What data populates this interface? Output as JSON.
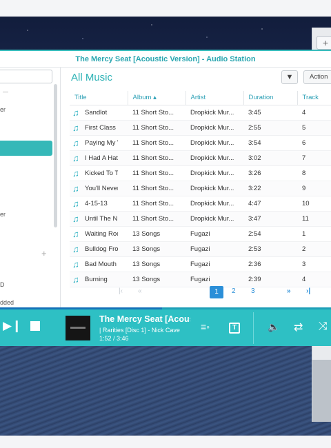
{
  "window": {
    "title": "The Mercy Seat [Acoustic Version] - Audio Station"
  },
  "sidebar": {
    "search_placeholder": "",
    "items": [
      {
        "label": "er"
      },
      {
        "label": "er"
      },
      {
        "label": "D"
      },
      {
        "label": "dded"
      }
    ]
  },
  "main": {
    "heading": "All Music",
    "action_label": "Action",
    "columns": [
      "Title",
      "Album ▴",
      "Artist",
      "Duration",
      "Track"
    ],
    "rows": [
      {
        "title": "Sandlot",
        "album": "11 Short Sto...",
        "artist": "Dropkick Mur...",
        "duration": "3:45",
        "track": "4"
      },
      {
        "title": "First Class I",
        "album": "11 Short Sto...",
        "artist": "Dropkick Mur...",
        "duration": "2:55",
        "track": "5"
      },
      {
        "title": "Paying My V",
        "album": "11 Short Sto...",
        "artist": "Dropkick Mur...",
        "duration": "3:54",
        "track": "6"
      },
      {
        "title": "I Had A Hat",
        "album": "11 Short Sto...",
        "artist": "Dropkick Mur...",
        "duration": "3:02",
        "track": "7"
      },
      {
        "title": "Kicked To T",
        "album": "11 Short Sto...",
        "artist": "Dropkick Mur...",
        "duration": "3:26",
        "track": "8"
      },
      {
        "title": "You'll Never",
        "album": "11 Short Sto...",
        "artist": "Dropkick Mur...",
        "duration": "3:22",
        "track": "9"
      },
      {
        "title": "4-15-13",
        "album": "11 Short Sto...",
        "artist": "Dropkick Mur...",
        "duration": "4:47",
        "track": "10"
      },
      {
        "title": "Until The N",
        "album": "11 Short Sto...",
        "artist": "Dropkick Mur...",
        "duration": "3:47",
        "track": "11"
      },
      {
        "title": "Waiting Roo",
        "album": "13 Songs",
        "artist": "Fugazi",
        "duration": "2:54",
        "track": "1"
      },
      {
        "title": "Bulldog Fro",
        "album": "13 Songs",
        "artist": "Fugazi",
        "duration": "2:53",
        "track": "2"
      },
      {
        "title": "Bad Mouth",
        "album": "13 Songs",
        "artist": "Fugazi",
        "duration": "2:36",
        "track": "3"
      },
      {
        "title": "Burning",
        "album": "13 Songs",
        "artist": "Fugazi",
        "duration": "2:39",
        "track": "4"
      }
    ],
    "pager": {
      "pages": [
        "1",
        "2",
        "3"
      ],
      "current": "1"
    }
  },
  "player": {
    "title": "The Mercy Seat [Acoustic Version]",
    "subtitle": "| Rarities [Disc 1] - Nick Cave",
    "time": "1:52 / 3:46",
    "progress": 0.49
  },
  "icons": {
    "note": "music-note-icon",
    "filter": "filter-icon",
    "next": "next-icon",
    "stop": "stop-icon",
    "queue": "queue-icon",
    "lyrics": "lyrics-icon",
    "volume": "volume-icon",
    "repeat": "repeat-icon",
    "shuffle": "shuffle-icon"
  },
  "colors": {
    "accent": "#2ec0c4",
    "title": "#2aa6b0",
    "link": "#2b8fd8"
  }
}
